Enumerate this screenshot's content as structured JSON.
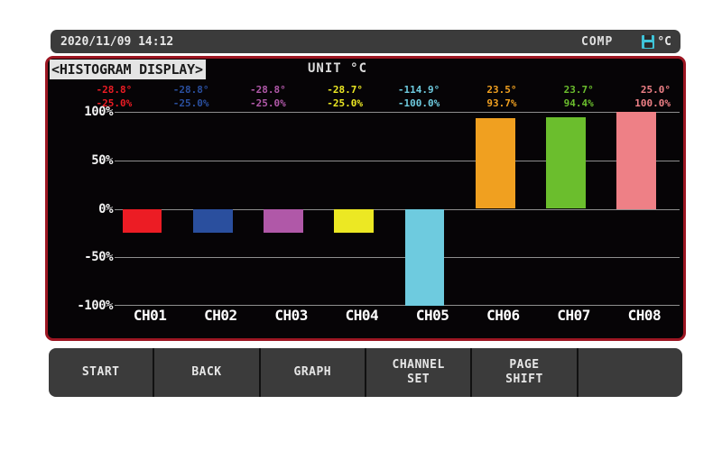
{
  "statusbar": {
    "datetime": "2020/11/09 14:12",
    "mode": "COMP",
    "media_icon": "floppy-disk-icon",
    "unit": "°C"
  },
  "screen": {
    "title": "<HISTOGRAM DISPLAY>",
    "unit_label": "UNIT °C",
    "border_color": "#9d1622",
    "background": "#060406"
  },
  "chart_data": {
    "type": "bar",
    "title": "<HISTOGRAM DISPLAY>",
    "xlabel": "",
    "ylabel": "%",
    "ylim": [
      -100,
      100
    ],
    "yticks": [
      "100%",
      "50%",
      "0%",
      "-50%",
      "-100%"
    ],
    "ytick_values": [
      100,
      50,
      0,
      -50,
      -100
    ],
    "grid": true,
    "legend": "none",
    "categories": [
      "CH01",
      "CH02",
      "CH03",
      "CH04",
      "CH05",
      "CH06",
      "CH07",
      "CH08"
    ],
    "values": [
      -25.0,
      -25.0,
      -25.0,
      -25.0,
      -100.0,
      93.7,
      94.4,
      100.0
    ],
    "colors": [
      "#ec1c24",
      "#2a4f9e",
      "#b058a8",
      "#ece823",
      "#6ecbdf",
      "#f0a020",
      "#6bbe2d",
      "#ee8086"
    ],
    "measurements": [
      "-28.8°",
      "-28.8°",
      "-28.8°",
      "-28.7°",
      "-114.9°",
      "23.5°",
      "23.7°",
      "25.0°"
    ],
    "percents": [
      "-25.0%",
      "-25.0%",
      "-25.0%",
      "-25.0%",
      "-100.0%",
      "93.7%",
      "94.4%",
      "100.0%"
    ]
  },
  "softkeys": [
    {
      "label": "START"
    },
    {
      "label": "BACK"
    },
    {
      "label": "GRAPH"
    },
    {
      "label": "CHANNEL\nSET"
    },
    {
      "label": "PAGE\nSHIFT"
    },
    {
      "label": ""
    }
  ]
}
